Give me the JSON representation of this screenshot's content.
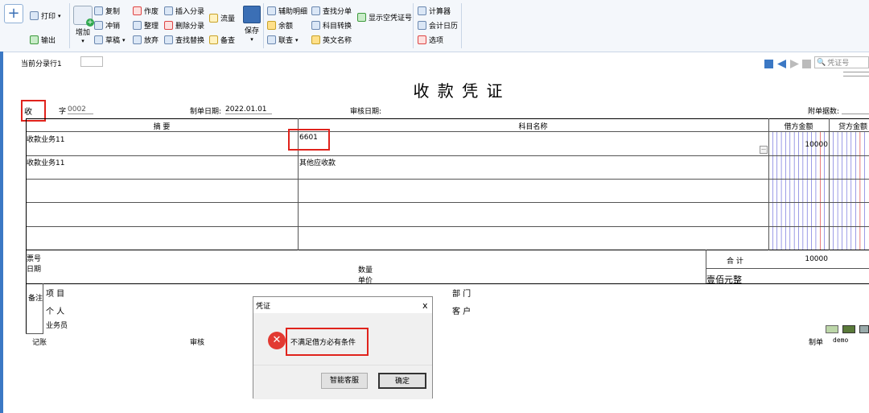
{
  "toolbar": {
    "print": "打印",
    "export": "输出",
    "add": "增加",
    "copy": "复制",
    "reverse": "冲销",
    "draft": "草稿",
    "void": "作废",
    "organize": "整理",
    "abandon": "放弃",
    "insert_entry": "插入分录",
    "delete_entry": "删除分录",
    "find_replace": "查找替换",
    "flow": "流量",
    "note": "备查",
    "save": "保存",
    "aux_detail": "辅助明细",
    "balance": "余额",
    "linked_query": "联查",
    "find_entry": "查找分单",
    "account_convert": "科目转换",
    "english_name": "英文名称",
    "show_empty_voucher": "显示空凭证号",
    "calculator": "计算器",
    "calendar": "会计日历",
    "options": "选项"
  },
  "current_entry_label": "当前分录行1",
  "search_placeholder": "凭证号",
  "voucher": {
    "title": "收 款 凭 证",
    "type": "收",
    "number_label": "字",
    "number": "0002",
    "date_label": "制单日期:",
    "date": "2022.01.01",
    "audit_date_label": "审核日期:",
    "attachments_label": "附单据数:",
    "col_summary": "摘 要",
    "col_account": "科目名称",
    "col_debit": "借方金额",
    "col_credit": "贷方金额",
    "rows": [
      {
        "summary": "收款业务11",
        "account": "6601",
        "debit": "10000"
      },
      {
        "summary": "收款业务11",
        "account": "其他应收款",
        "debit": ""
      }
    ],
    "ticket_no_label": "票号",
    "date_label2": "日期",
    "qty_label": "数量",
    "price_label": "单价",
    "total_label": "合 计",
    "total_debit": "10000",
    "total_words": "壹佰元整",
    "remark_label": "备注",
    "project_label": "项 目",
    "dept_label": "部 门",
    "person_label": "个 人",
    "customer_label": "客 户",
    "salesman_label": "业务员",
    "bookkeeping_label": "记账",
    "audit_label": "审核",
    "maker_label": "制单",
    "maker": "demo"
  },
  "dialog": {
    "title": "凭证",
    "close": "x",
    "message": "不满足借方必有条件",
    "service_button": "智能客服",
    "ok_button": "确定"
  },
  "colors": {
    "accent": "#3b78c4",
    "error": "#e0231c",
    "grid_blue": "#5b5bd6",
    "grid_red": "#d22"
  }
}
